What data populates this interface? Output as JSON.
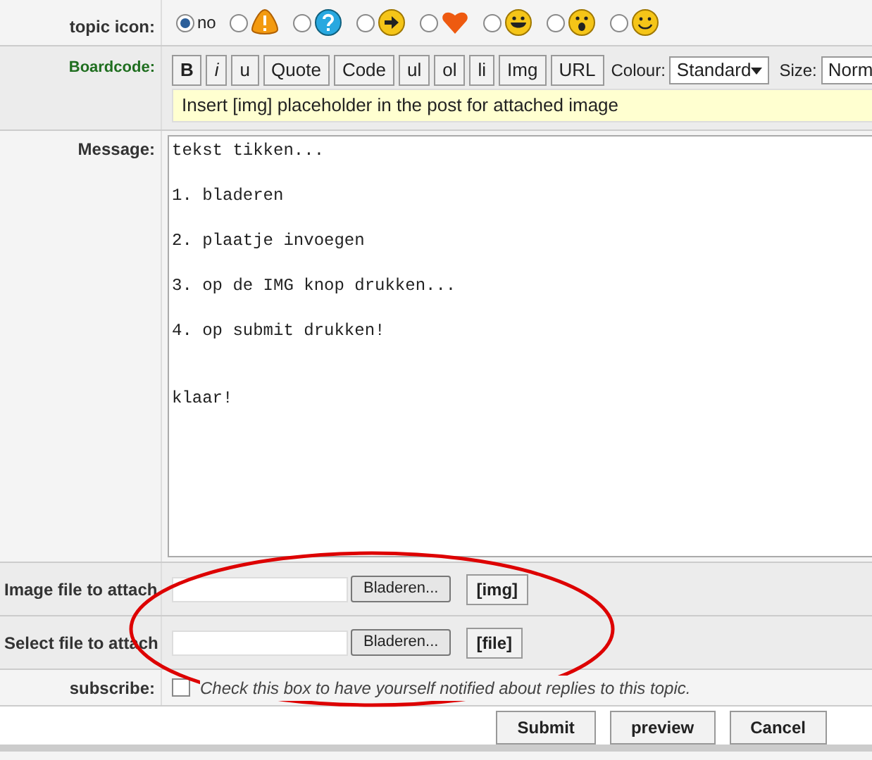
{
  "topic_icon": {
    "label": "topic icon:",
    "options": [
      {
        "kind": "none",
        "label": "no",
        "selected": true
      },
      {
        "kind": "warning",
        "selected": false
      },
      {
        "kind": "question",
        "selected": false
      },
      {
        "kind": "arrow",
        "selected": false
      },
      {
        "kind": "heart",
        "selected": false
      },
      {
        "kind": "grin",
        "selected": false
      },
      {
        "kind": "surprised",
        "selected": false
      },
      {
        "kind": "smile",
        "selected": false
      }
    ]
  },
  "boardcode": {
    "label": "Boardcode:",
    "buttons": [
      "B",
      "i",
      "u",
      "Quote",
      "Code",
      "ul",
      "ol",
      "li",
      "Img",
      "URL"
    ],
    "colour_label": "Colour:",
    "colour_value": "Standard",
    "size_label": "Size:",
    "size_value": "Norm",
    "hint": "Insert [img] placeholder in the post for attached image"
  },
  "message": {
    "label": "Message:",
    "lines": [
      "tekst tikken...",
      "1. bladeren",
      "2. plaatje invoegen",
      "3. op de IMG knop drukken...",
      "4. op submit drukken!",
      "klaar!"
    ]
  },
  "attachments": [
    {
      "label": "Image file to attach",
      "browse": "Bladeren...",
      "tag": "[img]"
    },
    {
      "label": "Select file to attach",
      "browse": "Bladeren...",
      "tag": "[file]"
    }
  ],
  "subscribe": {
    "label": "subscribe:",
    "checked": false,
    "text": "Check this box to have yourself notified about replies to this topic."
  },
  "actions": [
    "Submit",
    "preview",
    "Cancel"
  ],
  "annotation": {
    "kind": "ellipse",
    "color": "#dd0000"
  }
}
